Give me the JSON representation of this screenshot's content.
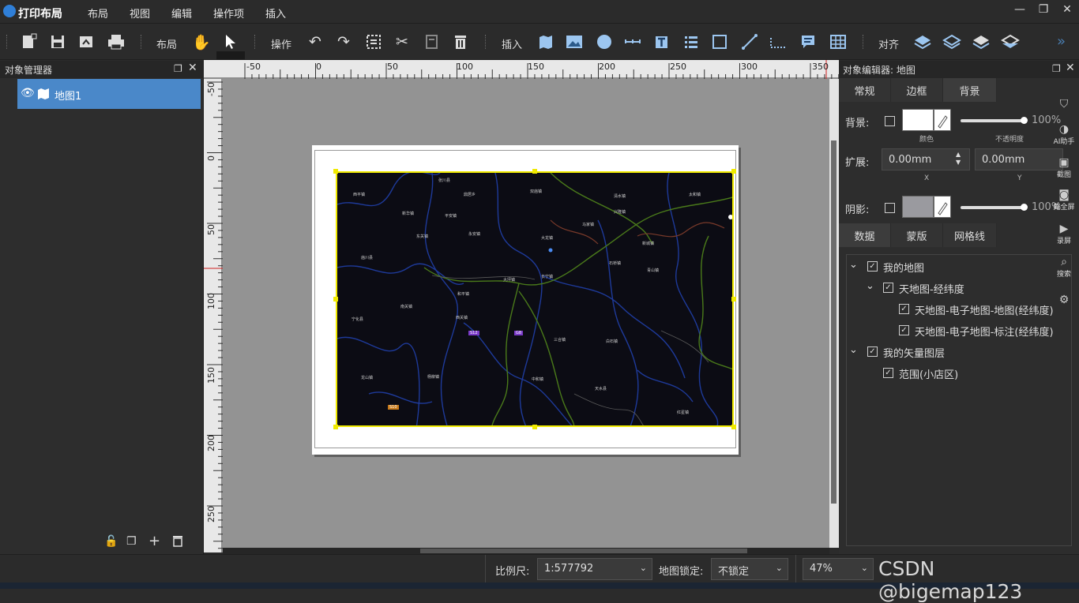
{
  "app": {
    "title": "打印布局",
    "brand_color": "#2f7fd8"
  },
  "menu": [
    "布局",
    "视图",
    "编辑",
    "操作项",
    "插入"
  ],
  "window_controls": {
    "minimize": "—",
    "restore": "❐",
    "close": "✕"
  },
  "toolbar": {
    "layout_label": "布局",
    "operate_label": "操作",
    "insert_label": "插入",
    "align_label": "对齐",
    "more": "»"
  },
  "object_manager": {
    "title": "对象管理器",
    "items": [
      {
        "label": "地图1"
      }
    ]
  },
  "ruler_top": [
    "-50",
    "0",
    "50",
    "100",
    "150",
    "200",
    "250",
    "300",
    "350"
  ],
  "ruler_left": [
    "-50",
    "0",
    "50",
    "100",
    "150",
    "200",
    "250"
  ],
  "map": {
    "labels": [
      "张川县",
      "鼎居乡",
      "西平镇",
      "双庙镇",
      "大龙镇",
      "清水镇",
      "新华镇",
      "平安镇",
      "兴隆镇",
      "马家镇",
      "太和镇",
      "东关镇",
      "永安镇",
      "石桥镇",
      "新城镇",
      "庙川县",
      "和平镇",
      "大坪镇",
      "长宁镇",
      "青山镇",
      "南关镇",
      "宁化县",
      "西关镇",
      "三合镇",
      "白石镇",
      "龙山镇",
      "杨柳镇",
      "中和镇",
      "天水县",
      "红星镇"
    ],
    "road_badges": [
      "S12",
      "G8",
      "S10"
    ]
  },
  "object_editor": {
    "title": "对象编辑器: 地图",
    "tabs": [
      "常规",
      "边框",
      "背景"
    ],
    "active_tab": "背景",
    "background_label": "背景:",
    "color_caption": "颜色",
    "opacity_caption": "不透明度",
    "background_opacity": "100%",
    "extend_label": "扩展:",
    "extend_x": "0.00mm",
    "extend_y": "0.00mm",
    "x_caption": "X",
    "y_caption": "Y",
    "shadow_label": "阴影:",
    "shadow_opacity": "100%",
    "lower_tabs": [
      "数据",
      "蒙版",
      "网格线"
    ],
    "tree": [
      {
        "label": "我的地图",
        "expander": "⌄"
      },
      {
        "label": "天地图-经纬度",
        "expander": "⌄"
      },
      {
        "label": "天地图-电子地图-地图(经纬度)"
      },
      {
        "label": "天地图-电子地图-标注(经纬度)"
      },
      {
        "label": "我的矢量图层",
        "expander": "⌄"
      },
      {
        "label": "范围(小店区)"
      }
    ]
  },
  "side_tools": [
    "AI助手",
    "截图",
    "截全屏",
    "录屏",
    "搜索"
  ],
  "status": {
    "scale_label": "比例尺:",
    "scale_value": "1:577792",
    "lock_label": "地图锁定:",
    "lock_value": "不锁定",
    "zoom_value": "47%"
  },
  "watermark": "CSDN @bigemap123"
}
